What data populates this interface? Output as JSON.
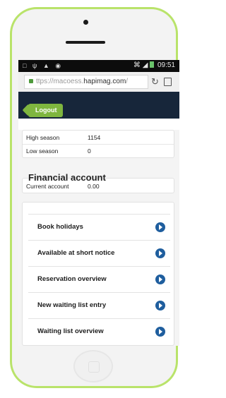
{
  "status_bar": {
    "time": "09:51"
  },
  "browser": {
    "url_prefix": "ttps://macoess.",
    "url_host": "hapimag.com",
    "url_suffix": "/"
  },
  "header": {
    "logout_label": "Logout"
  },
  "season": [
    {
      "label": "High season",
      "value": "1154"
    },
    {
      "label": "Low season",
      "value": "0"
    }
  ],
  "financial": {
    "title": "Financial account",
    "rows": [
      {
        "label": "Current account",
        "value": "0.00"
      }
    ]
  },
  "menu": [
    {
      "label": "Book holidays"
    },
    {
      "label": "Available at short notice"
    },
    {
      "label": "Reservation overview"
    },
    {
      "label": "New waiting list entry"
    },
    {
      "label": "Waiting list overview"
    }
  ],
  "colors": {
    "phone_shell": "#b9e36a",
    "header": "#17263a",
    "logout": "#7fb63f",
    "arrow_button": "#1f5e9e"
  }
}
